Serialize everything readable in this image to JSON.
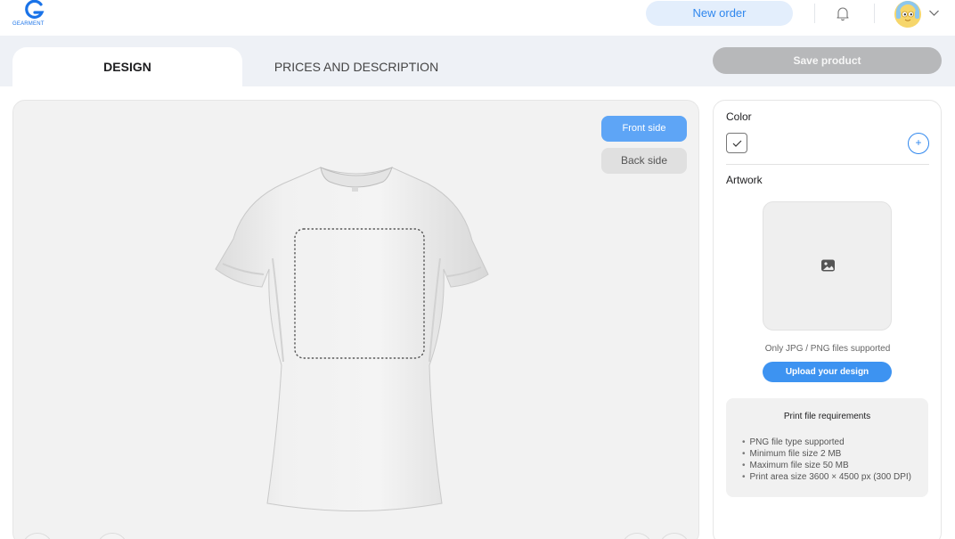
{
  "header": {
    "logo_text": "GEARMENT",
    "new_order_label": "New order"
  },
  "tabs": [
    {
      "label": "DESIGN",
      "active": true
    },
    {
      "label": "PRICES AND DESCRIPTION",
      "active": false
    }
  ],
  "toolbar": {
    "save_label": "Save product"
  },
  "canvas": {
    "front_label": "Front side",
    "back_label": "Back side",
    "active_side": "front"
  },
  "panel": {
    "color_label": "Color",
    "add_color_symbol": "+",
    "artwork_label": "Artwork",
    "file_note": "Only JPG / PNG files supported",
    "upload_label": "Upload your design",
    "requirements_title": "Print file requirements",
    "requirements": [
      "PNG file type supported",
      "Minimum file size 2 MB",
      "Maximum file size 50 MB",
      "Print area size 3600 × 4500 px (300 DPI)"
    ]
  },
  "colors": {
    "accent": "#2f87ee",
    "accent_light": "#e3eefc",
    "front_button": "#5ea5f6",
    "disabled_button": "#b7b8ba",
    "selected_swatch": "#ffffff"
  },
  "icons": [
    "gearment-logo-icon",
    "bell-icon",
    "avatar",
    "chevron-down-icon",
    "check-icon",
    "plus-icon",
    "image-icon"
  ]
}
